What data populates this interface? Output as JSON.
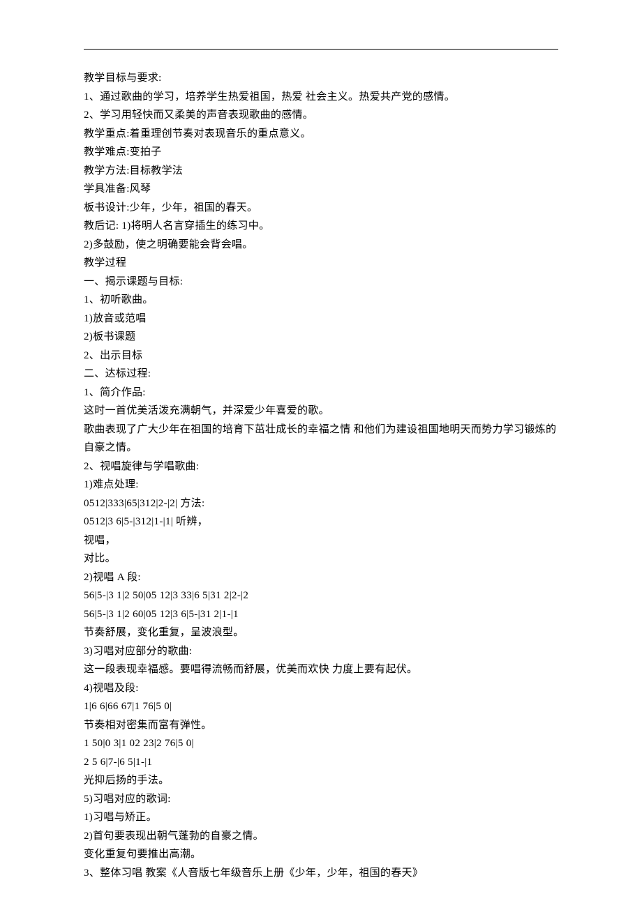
{
  "lines": [
    "教学目标与要求:",
    "1、通过歌曲的学习，培养学生热爱祖国，热爱 社会主义。热爱共产党的感情。",
    "2、学习用轻快而又柔美的声音表现歌曲的感情。",
    "教学重点:着重理创节奏对表现音乐的重点意义。",
    "教学难点:变拍子",
    "教学方法:目标教学法",
    "学具准备:风琴",
    "板书设计:少年，少年，祖国的春天。",
    "教后记: 1)将明人名言穿插生的练习中。",
    "2)多鼓励，使之明确要能会背会唱。",
    "教学过程",
    "一、揭示课题与目标:",
    "1、初听歌曲。",
    "1)放音或范唱",
    "2)板书课题",
    "2、出示目标",
    "二、达标过程:",
    "1、简介作品:",
    "这时一首优美活泼充满朝气，并深爱少年喜爱的歌。",
    "歌曲表现了广大少年在祖国的培育下茁壮成长的幸福之情 和他们为建设祖国地明天而势力学习锻炼的自豪之情。",
    "2、视唱旋律与学唱歌曲:",
    "1)难点处理:",
    "0512|333|65|312|2-|2| 方法:",
    "0512|3 6|5-|312|1-|1| 听辨，",
    "视唱，",
    "对比。",
    "2)视唱 A 段:",
    "56|5-|3 1|2 50|05 12|3 33|6 5|31 2|2-|2",
    "56|5-|3 1|2 60|05 12|3 6|5-|31 2|1-|1",
    "节奏舒展，变化重复，呈波浪型。",
    "3)习唱对应部分的歌曲:",
    "这一段表现幸福感。要唱得流畅而舒展，优美而欢快 力度上要有起伏。",
    "4)视唱及段:",
    "1|6 6|66 67|1 76|5 0|",
    "节奏相对密集而富有弹性。",
    "1 50|0 3|1 02 23|2 76|5 0|",
    "2 5 6|7-|6 5|1-|1",
    "光抑后扬的手法。",
    "5)习唱对应的歌词:",
    "1)习唱与矫正。",
    "2)首句要表现出朝气蓬勃的自豪之情。",
    "变化重复句要推出高潮。",
    "3、整体习唱 教案《人音版七年级音乐上册《少年，少年，祖国的春天》"
  ]
}
